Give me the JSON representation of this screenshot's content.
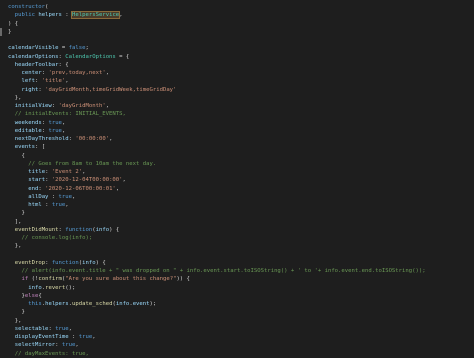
{
  "lines": [
    {
      "indent": "",
      "tokens": [
        {
          "t": "constructor",
          "c": "keyword"
        },
        {
          "t": "(",
          "c": "punc"
        }
      ]
    },
    {
      "indent": "  ",
      "tokens": [
        {
          "t": "public",
          "c": "keyword"
        },
        {
          "t": " ",
          "c": "plain"
        },
        {
          "t": "helpers",
          "c": "prop"
        },
        {
          "t": " : ",
          "c": "punc"
        },
        {
          "t": "HelpersService",
          "c": "highlight"
        },
        {
          "t": ",",
          "c": "punc"
        }
      ]
    },
    {
      "indent": "",
      "tokens": [
        {
          "t": ") {",
          "c": "punc"
        }
      ]
    },
    {
      "indent": "",
      "tokens": [
        {
          "t": "}",
          "c": "punc"
        }
      ],
      "cursor": true
    },
    {
      "indent": "",
      "tokens": [],
      "blank": true
    },
    {
      "indent": "",
      "tokens": [
        {
          "t": "calendarVisible",
          "c": "prop"
        },
        {
          "t": " = ",
          "c": "punc"
        },
        {
          "t": "false",
          "c": "keyword"
        },
        {
          "t": ";",
          "c": "punc"
        }
      ]
    },
    {
      "indent": "",
      "tokens": [
        {
          "t": "calendarOptions",
          "c": "prop"
        },
        {
          "t": ": ",
          "c": "punc"
        },
        {
          "t": "CalendarOptions",
          "c": "type"
        },
        {
          "t": " = {",
          "c": "punc"
        }
      ]
    },
    {
      "indent": "  ",
      "tokens": [
        {
          "t": "headerToolbar",
          "c": "prop"
        },
        {
          "t": ": {",
          "c": "punc"
        }
      ]
    },
    {
      "indent": "    ",
      "tokens": [
        {
          "t": "center",
          "c": "prop"
        },
        {
          "t": ": ",
          "c": "punc"
        },
        {
          "t": "'prev,today,next'",
          "c": "string"
        },
        {
          "t": ",",
          "c": "punc"
        }
      ]
    },
    {
      "indent": "    ",
      "tokens": [
        {
          "t": "left",
          "c": "prop"
        },
        {
          "t": ": ",
          "c": "punc"
        },
        {
          "t": "'title'",
          "c": "string"
        },
        {
          "t": ",",
          "c": "punc"
        }
      ]
    },
    {
      "indent": "    ",
      "tokens": [
        {
          "t": "right",
          "c": "prop"
        },
        {
          "t": ": ",
          "c": "punc"
        },
        {
          "t": "'dayGridMonth,timeGridWeek,timeGridDay'",
          "c": "string"
        }
      ]
    },
    {
      "indent": "  ",
      "tokens": [
        {
          "t": "},",
          "c": "punc"
        }
      ]
    },
    {
      "indent": "  ",
      "tokens": [
        {
          "t": "initialView",
          "c": "prop"
        },
        {
          "t": ": ",
          "c": "punc"
        },
        {
          "t": "'dayGridMonth'",
          "c": "string"
        },
        {
          "t": ",",
          "c": "punc"
        }
      ]
    },
    {
      "indent": "  ",
      "tokens": [
        {
          "t": "// initialEvents: INITIAL_EVENTS,",
          "c": "comment"
        }
      ]
    },
    {
      "indent": "  ",
      "tokens": [
        {
          "t": "weekends",
          "c": "prop"
        },
        {
          "t": ": ",
          "c": "punc"
        },
        {
          "t": "true",
          "c": "keyword"
        },
        {
          "t": ",",
          "c": "punc"
        }
      ]
    },
    {
      "indent": "  ",
      "tokens": [
        {
          "t": "editable",
          "c": "prop"
        },
        {
          "t": ": ",
          "c": "punc"
        },
        {
          "t": "true",
          "c": "keyword"
        },
        {
          "t": ",",
          "c": "punc"
        }
      ]
    },
    {
      "indent": "  ",
      "tokens": [
        {
          "t": "nextDayThreshold",
          "c": "prop"
        },
        {
          "t": ": ",
          "c": "punc"
        },
        {
          "t": "'00:00:00'",
          "c": "string"
        },
        {
          "t": ",",
          "c": "punc"
        }
      ]
    },
    {
      "indent": "  ",
      "tokens": [
        {
          "t": "events",
          "c": "prop"
        },
        {
          "t": ": [",
          "c": "punc"
        }
      ]
    },
    {
      "indent": "    ",
      "tokens": [
        {
          "t": "{",
          "c": "punc"
        }
      ]
    },
    {
      "indent": "      ",
      "tokens": [
        {
          "t": "// Goes from 8am to 10am the next day.",
          "c": "comment"
        }
      ]
    },
    {
      "indent": "      ",
      "tokens": [
        {
          "t": "title",
          "c": "prop"
        },
        {
          "t": ": ",
          "c": "punc"
        },
        {
          "t": "'Event 2'",
          "c": "string"
        },
        {
          "t": ",",
          "c": "punc"
        }
      ]
    },
    {
      "indent": "      ",
      "tokens": [
        {
          "t": "start",
          "c": "prop"
        },
        {
          "t": ": ",
          "c": "punc"
        },
        {
          "t": "'2020-12-04T00:00:00'",
          "c": "string"
        },
        {
          "t": ",",
          "c": "punc"
        }
      ]
    },
    {
      "indent": "      ",
      "tokens": [
        {
          "t": "end",
          "c": "prop"
        },
        {
          "t": ": ",
          "c": "punc"
        },
        {
          "t": "'2020-12-06T00:00:01'",
          "c": "string"
        },
        {
          "t": ",",
          "c": "punc"
        }
      ]
    },
    {
      "indent": "      ",
      "tokens": [
        {
          "t": "allDay",
          "c": "prop"
        },
        {
          "t": " : ",
          "c": "punc"
        },
        {
          "t": "true",
          "c": "keyword"
        },
        {
          "t": ",",
          "c": "punc"
        }
      ]
    },
    {
      "indent": "      ",
      "tokens": [
        {
          "t": "html",
          "c": "prop"
        },
        {
          "t": " : ",
          "c": "punc"
        },
        {
          "t": "true",
          "c": "keyword"
        },
        {
          "t": ",",
          "c": "punc"
        }
      ]
    },
    {
      "indent": "    ",
      "tokens": [
        {
          "t": "}",
          "c": "punc"
        }
      ]
    },
    {
      "indent": "  ",
      "tokens": [
        {
          "t": "],",
          "c": "punc"
        }
      ]
    },
    {
      "indent": "  ",
      "tokens": [
        {
          "t": "eventDidMount",
          "c": "func"
        },
        {
          "t": ": ",
          "c": "punc"
        },
        {
          "t": "function",
          "c": "keyword"
        },
        {
          "t": "(",
          "c": "punc"
        },
        {
          "t": "info",
          "c": "prop"
        },
        {
          "t": ") {",
          "c": "punc"
        }
      ]
    },
    {
      "indent": "    ",
      "tokens": [
        {
          "t": "// console.log(info);",
          "c": "comment"
        }
      ]
    },
    {
      "indent": "  ",
      "tokens": [
        {
          "t": "},",
          "c": "punc"
        }
      ]
    },
    {
      "indent": "",
      "tokens": [],
      "blank": true
    },
    {
      "indent": "  ",
      "tokens": [
        {
          "t": "eventDrop",
          "c": "func"
        },
        {
          "t": ": ",
          "c": "punc"
        },
        {
          "t": "function",
          "c": "keyword"
        },
        {
          "t": "(",
          "c": "punc"
        },
        {
          "t": "info",
          "c": "prop"
        },
        {
          "t": ") {",
          "c": "punc"
        }
      ]
    },
    {
      "indent": "    ",
      "tokens": [
        {
          "t": "// alert(info.event.title + \" was dropped on \" + info.event.start.toISOString() + ' to '+ info.event.end.toISOString());",
          "c": "comment"
        }
      ]
    },
    {
      "indent": "    ",
      "tokens": [
        {
          "t": "if",
          "c": "control"
        },
        {
          "t": " (!",
          "c": "punc"
        },
        {
          "t": "confirm",
          "c": "func"
        },
        {
          "t": "(",
          "c": "punc"
        },
        {
          "t": "\"Are you sure about this change?\"",
          "c": "string"
        },
        {
          "t": ")) {",
          "c": "punc"
        }
      ]
    },
    {
      "indent": "      ",
      "tokens": [
        {
          "t": "info",
          "c": "prop"
        },
        {
          "t": ".",
          "c": "punc"
        },
        {
          "t": "revert",
          "c": "func"
        },
        {
          "t": "();",
          "c": "punc"
        }
      ]
    },
    {
      "indent": "    ",
      "tokens": [
        {
          "t": "}",
          "c": "punc"
        },
        {
          "t": "else",
          "c": "control"
        },
        {
          "t": "{",
          "c": "punc"
        }
      ]
    },
    {
      "indent": "      ",
      "tokens": [
        {
          "t": "this",
          "c": "keyword"
        },
        {
          "t": ".",
          "c": "punc"
        },
        {
          "t": "helpers",
          "c": "prop"
        },
        {
          "t": ".",
          "c": "punc"
        },
        {
          "t": "update_sched",
          "c": "func"
        },
        {
          "t": "(",
          "c": "punc"
        },
        {
          "t": "info",
          "c": "prop"
        },
        {
          "t": ".",
          "c": "punc"
        },
        {
          "t": "event",
          "c": "prop"
        },
        {
          "t": ");",
          "c": "punc"
        }
      ]
    },
    {
      "indent": "    ",
      "tokens": [
        {
          "t": "}",
          "c": "punc"
        }
      ]
    },
    {
      "indent": "  ",
      "tokens": [
        {
          "t": "},",
          "c": "punc"
        }
      ]
    },
    {
      "indent": "  ",
      "tokens": [
        {
          "t": "selectable",
          "c": "prop"
        },
        {
          "t": ": ",
          "c": "punc"
        },
        {
          "t": "true",
          "c": "keyword"
        },
        {
          "t": ",",
          "c": "punc"
        }
      ]
    },
    {
      "indent": "  ",
      "tokens": [
        {
          "t": "displayEventTime",
          "c": "prop"
        },
        {
          "t": " : ",
          "c": "punc"
        },
        {
          "t": "true",
          "c": "keyword"
        },
        {
          "t": ",",
          "c": "punc"
        }
      ]
    },
    {
      "indent": "  ",
      "tokens": [
        {
          "t": "selectMirror",
          "c": "prop"
        },
        {
          "t": ": ",
          "c": "punc"
        },
        {
          "t": "true",
          "c": "keyword"
        },
        {
          "t": ",",
          "c": "punc"
        }
      ]
    },
    {
      "indent": "  ",
      "tokens": [
        {
          "t": "// dayMaxEvents: true,",
          "c": "comment"
        }
      ]
    }
  ]
}
